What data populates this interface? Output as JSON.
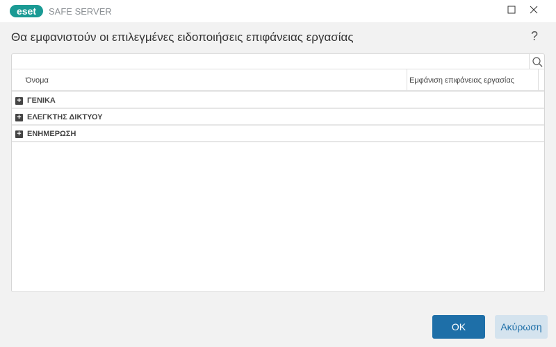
{
  "window": {
    "logo": "eset",
    "product": "SAFE SERVER"
  },
  "dialog": {
    "title": "Θα εμφανιστούν οι επιλεγμένες ειδοποιήσεις επιφάνειας εργασίας",
    "help": "?"
  },
  "search": {
    "value": "",
    "placeholder": ""
  },
  "table": {
    "columns": [
      "Όνομα",
      "Εμφάνιση επιφάνειας εργασίας"
    ],
    "groups": [
      {
        "label": "ΓΕΝΙΚΑ"
      },
      {
        "label": "ΕΛΕΓΚΤΗΣ ΔΙΚΤΥΟΥ"
      },
      {
        "label": "ΕΝΗΜΕΡΩΣΗ"
      }
    ]
  },
  "buttons": {
    "ok": "OK",
    "cancel": "Ακύρωση"
  }
}
